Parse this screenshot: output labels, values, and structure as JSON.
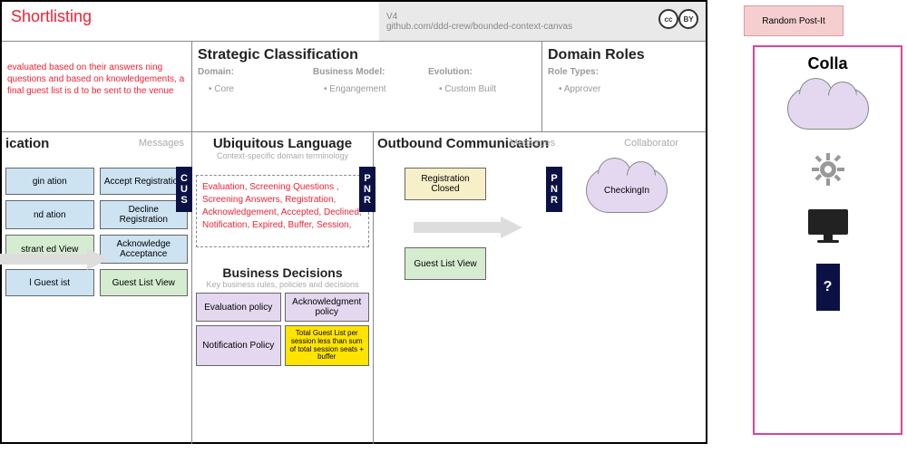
{
  "header": {
    "title": "Shortlisting",
    "meta_version": "V4",
    "meta_url": "github.com/ddd-crew/bounded-context-canvas",
    "cc": "cc",
    "by": "BY"
  },
  "description": "evaluated based on their answers ning questions and based on knowledgements, a final guest list is d to be sent to the venue",
  "strat": {
    "title": "Strategic Classification",
    "domain_label": "Domain:",
    "domain_item": "Core",
    "model_label": "Business Model:",
    "model_item": "Engangement",
    "evo_label": "Evolution:",
    "evo_item": "Custom Built"
  },
  "roles": {
    "title": "Domain Roles",
    "types_label": "Role Types:",
    "approver": "Approver"
  },
  "inbound": {
    "title": "ication",
    "messages_label": "Messages",
    "cards": {
      "c1": "gin ation",
      "c2": "Accept Registration",
      "c3": "nd ation",
      "c4": "Decline Registration",
      "c5": "strant ed View",
      "c6": "Acknowledge Acceptance",
      "c7": "l Guest ist",
      "c8": "Guest List View"
    }
  },
  "ubiq": {
    "title": "Ubiquitous Language",
    "subtitle": "Context-specific domain terminology",
    "text": "Evaluation, Screening Questions , Screening Answers, Registration, Acknowledgement, Accepted, Declined, Notification, Expired, Buffer, Session,",
    "biz_title": "Business Decisions",
    "biz_subtitle": "Key business rules, policies and decisions",
    "b1": "Evaluation policy",
    "b2": "Acknowledgment policy",
    "b3": "Notification Policy",
    "b4": "Total Guest List per session less than sum of total session seats + buffer"
  },
  "outbound": {
    "title": "Outbound Communication",
    "messages_label": "Messages",
    "collab_label": "Collaborator",
    "reg_closed": "Registration Closed",
    "guest_view": "Guest List View",
    "checkin": "CheckingIn"
  },
  "bars": {
    "cus": [
      "C",
      "U",
      "S"
    ],
    "pnr": [
      "P",
      "N",
      "R"
    ]
  },
  "postit": "Random Post-It",
  "right": {
    "title": "Colla",
    "q": "?"
  }
}
